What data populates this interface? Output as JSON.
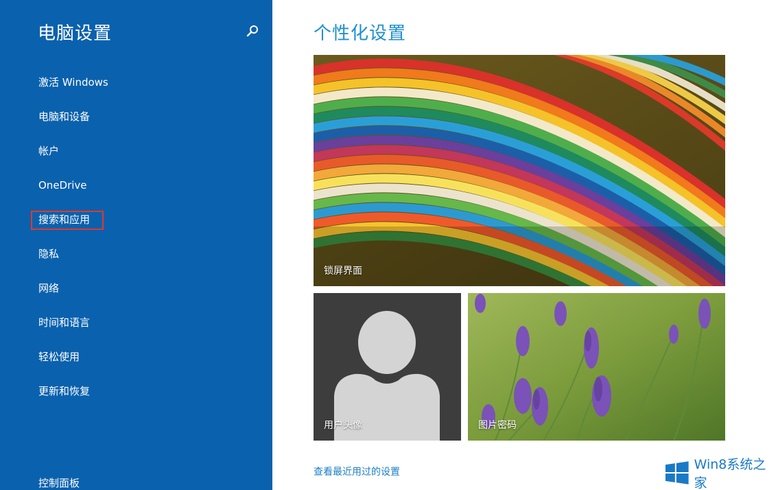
{
  "sidebar": {
    "title": "电脑设置",
    "search_icon": "search-icon",
    "items": [
      {
        "label": "激活 Windows"
      },
      {
        "label": "电脑和设备"
      },
      {
        "label": "帐户"
      },
      {
        "label": "OneDrive"
      },
      {
        "label": "搜索和应用",
        "highlighted": true
      },
      {
        "label": "隐私"
      },
      {
        "label": "网络"
      },
      {
        "label": "时间和语言"
      },
      {
        "label": "轻松使用"
      },
      {
        "label": "更新和恢复"
      }
    ],
    "control_panel": "控制面板"
  },
  "main": {
    "title": "个性化设置",
    "tiles": {
      "lock_screen": "锁屏界面",
      "account_picture": "用户头像",
      "picture_password": "图片密码"
    },
    "recent_link": "查看最近用过的设置"
  },
  "watermark": {
    "text": "Win8系统之家",
    "icon": "windows-logo-icon"
  },
  "colors": {
    "sidebar_bg": "#0a61ad",
    "title_blue": "#1f8fd2",
    "highlight_border": "#e2382b"
  }
}
